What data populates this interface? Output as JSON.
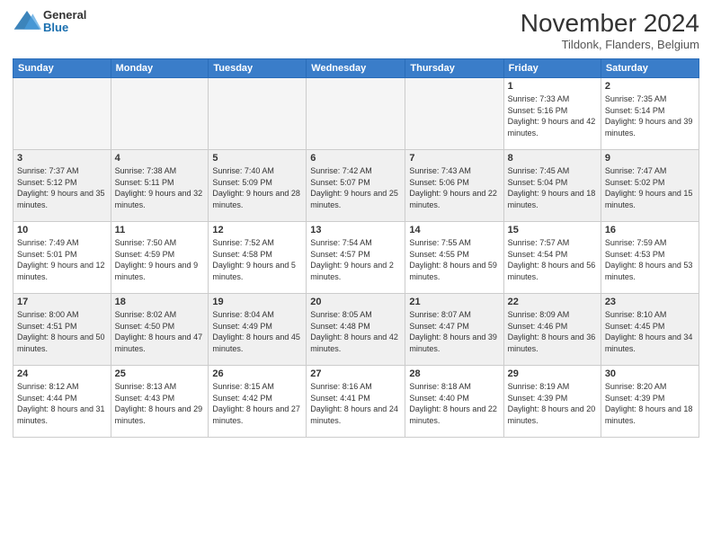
{
  "header": {
    "logo_general": "General",
    "logo_blue": "Blue",
    "month_title": "November 2024",
    "location": "Tildonk, Flanders, Belgium"
  },
  "days_of_week": [
    "Sunday",
    "Monday",
    "Tuesday",
    "Wednesday",
    "Thursday",
    "Friday",
    "Saturday"
  ],
  "weeks": [
    [
      {
        "day": "",
        "empty": true
      },
      {
        "day": "",
        "empty": true
      },
      {
        "day": "",
        "empty": true
      },
      {
        "day": "",
        "empty": true
      },
      {
        "day": "",
        "empty": true
      },
      {
        "day": "1",
        "sunrise": "7:33 AM",
        "sunset": "5:16 PM",
        "daylight": "9 hours and 42 minutes."
      },
      {
        "day": "2",
        "sunrise": "7:35 AM",
        "sunset": "5:14 PM",
        "daylight": "9 hours and 39 minutes."
      }
    ],
    [
      {
        "day": "3",
        "sunrise": "7:37 AM",
        "sunset": "5:12 PM",
        "daylight": "9 hours and 35 minutes."
      },
      {
        "day": "4",
        "sunrise": "7:38 AM",
        "sunset": "5:11 PM",
        "daylight": "9 hours and 32 minutes."
      },
      {
        "day": "5",
        "sunrise": "7:40 AM",
        "sunset": "5:09 PM",
        "daylight": "9 hours and 28 minutes."
      },
      {
        "day": "6",
        "sunrise": "7:42 AM",
        "sunset": "5:07 PM",
        "daylight": "9 hours and 25 minutes."
      },
      {
        "day": "7",
        "sunrise": "7:43 AM",
        "sunset": "5:06 PM",
        "daylight": "9 hours and 22 minutes."
      },
      {
        "day": "8",
        "sunrise": "7:45 AM",
        "sunset": "5:04 PM",
        "daylight": "9 hours and 18 minutes."
      },
      {
        "day": "9",
        "sunrise": "7:47 AM",
        "sunset": "5:02 PM",
        "daylight": "9 hours and 15 minutes."
      }
    ],
    [
      {
        "day": "10",
        "sunrise": "7:49 AM",
        "sunset": "5:01 PM",
        "daylight": "9 hours and 12 minutes."
      },
      {
        "day": "11",
        "sunrise": "7:50 AM",
        "sunset": "4:59 PM",
        "daylight": "9 hours and 9 minutes."
      },
      {
        "day": "12",
        "sunrise": "7:52 AM",
        "sunset": "4:58 PM",
        "daylight": "9 hours and 5 minutes."
      },
      {
        "day": "13",
        "sunrise": "7:54 AM",
        "sunset": "4:57 PM",
        "daylight": "9 hours and 2 minutes."
      },
      {
        "day": "14",
        "sunrise": "7:55 AM",
        "sunset": "4:55 PM",
        "daylight": "8 hours and 59 minutes."
      },
      {
        "day": "15",
        "sunrise": "7:57 AM",
        "sunset": "4:54 PM",
        "daylight": "8 hours and 56 minutes."
      },
      {
        "day": "16",
        "sunrise": "7:59 AM",
        "sunset": "4:53 PM",
        "daylight": "8 hours and 53 minutes."
      }
    ],
    [
      {
        "day": "17",
        "sunrise": "8:00 AM",
        "sunset": "4:51 PM",
        "daylight": "8 hours and 50 minutes."
      },
      {
        "day": "18",
        "sunrise": "8:02 AM",
        "sunset": "4:50 PM",
        "daylight": "8 hours and 47 minutes."
      },
      {
        "day": "19",
        "sunrise": "8:04 AM",
        "sunset": "4:49 PM",
        "daylight": "8 hours and 45 minutes."
      },
      {
        "day": "20",
        "sunrise": "8:05 AM",
        "sunset": "4:48 PM",
        "daylight": "8 hours and 42 minutes."
      },
      {
        "day": "21",
        "sunrise": "8:07 AM",
        "sunset": "4:47 PM",
        "daylight": "8 hours and 39 minutes."
      },
      {
        "day": "22",
        "sunrise": "8:09 AM",
        "sunset": "4:46 PM",
        "daylight": "8 hours and 36 minutes."
      },
      {
        "day": "23",
        "sunrise": "8:10 AM",
        "sunset": "4:45 PM",
        "daylight": "8 hours and 34 minutes."
      }
    ],
    [
      {
        "day": "24",
        "sunrise": "8:12 AM",
        "sunset": "4:44 PM",
        "daylight": "8 hours and 31 minutes."
      },
      {
        "day": "25",
        "sunrise": "8:13 AM",
        "sunset": "4:43 PM",
        "daylight": "8 hours and 29 minutes."
      },
      {
        "day": "26",
        "sunrise": "8:15 AM",
        "sunset": "4:42 PM",
        "daylight": "8 hours and 27 minutes."
      },
      {
        "day": "27",
        "sunrise": "8:16 AM",
        "sunset": "4:41 PM",
        "daylight": "8 hours and 24 minutes."
      },
      {
        "day": "28",
        "sunrise": "8:18 AM",
        "sunset": "4:40 PM",
        "daylight": "8 hours and 22 minutes."
      },
      {
        "day": "29",
        "sunrise": "8:19 AM",
        "sunset": "4:39 PM",
        "daylight": "8 hours and 20 minutes."
      },
      {
        "day": "30",
        "sunrise": "8:20 AM",
        "sunset": "4:39 PM",
        "daylight": "8 hours and 18 minutes."
      }
    ]
  ]
}
